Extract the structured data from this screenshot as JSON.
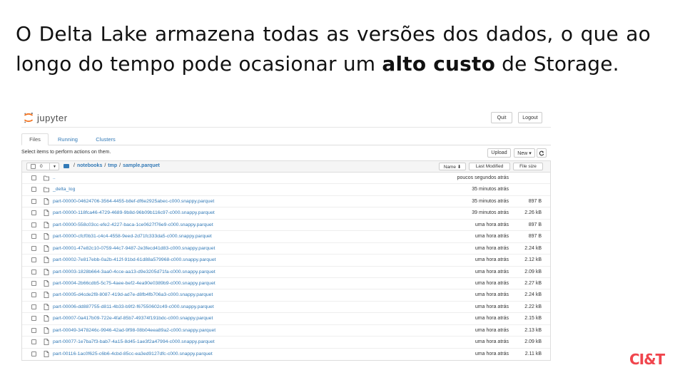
{
  "headline": {
    "text_before": "O Delta Lake armazena todas as versões dos dados, o que ao longo do tempo pode ocasionar um ",
    "bold": "alto custo",
    "text_after": " de Storage."
  },
  "jupyter": {
    "logo_text": "jupyter",
    "quit_label": "Quit",
    "logout_label": "Logout",
    "tabs": [
      "Files",
      "Running",
      "Clusters"
    ],
    "select_text": "Select items to perform actions on them.",
    "upload_label": "Upload",
    "new_label": "New ▾",
    "refresh_icon": "refresh-icon",
    "selected_count": "0",
    "breadcrumb": [
      "notebooks",
      "tmp",
      "sample.parquet"
    ],
    "sort_name_label": "Name ⬇",
    "sort_modified_label": "Last Modified",
    "sort_size_label": "File size",
    "rows": [
      {
        "name": "..",
        "modified": "poucos segundos atrás",
        "size": "",
        "type": "folder"
      },
      {
        "name": "_delta_log",
        "modified": "35 minutos atrás",
        "size": "",
        "type": "folder"
      },
      {
        "name": "part-00000-04624706-3564-4455-b8ef-df6e2925abec-c000.snappy.parquet",
        "modified": "35 minutos atrás",
        "size": "897 B",
        "type": "file"
      },
      {
        "name": "part-00000-118fca46-4729-4689-9b8d-96b09b116c97-c000.snappy.parquet",
        "modified": "39 minutos atrás",
        "size": "2.26 kB",
        "type": "file"
      },
      {
        "name": "part-00000-558c03cc-efe2-4227-baca-1ce0627f76e9-c000.snappy.parquet",
        "modified": "uma hora atrás",
        "size": "897 B",
        "type": "file"
      },
      {
        "name": "part-00000-cfcf0b31-c4c4-4558-9eed-2d71fc333da5-c000.snappy.parquet",
        "modified": "uma hora atrás",
        "size": "897 B",
        "type": "file"
      },
      {
        "name": "part-00001-47e82c10-0759-44c7-9487-2e3fecd41d83-c000.snappy.parquet",
        "modified": "uma hora atrás",
        "size": "2.24 kB",
        "type": "file"
      },
      {
        "name": "part-00002-7e817ebb-0a2b-412f-91bd-61d88a579968-c000.snappy.parquet",
        "modified": "uma hora atrás",
        "size": "2.12 kB",
        "type": "file"
      },
      {
        "name": "part-00003-1828b664-3aa0-4cce-aa13-d9e3205d71fa-c000.snappy.parquet",
        "modified": "uma hora atrás",
        "size": "2.09 kB",
        "type": "file"
      },
      {
        "name": "part-00004-2b66cdb5-5c75-4aee-bef2-4ea90e0389b9-c000.snappy.parquet",
        "modified": "uma hora atrás",
        "size": "2.27 kB",
        "type": "file"
      },
      {
        "name": "part-00005-d4cde2f8-8087-419d-ad7e-d8fb4fb706a3-c000.snappy.parquet",
        "modified": "uma hora atrás",
        "size": "2.24 kB",
        "type": "file"
      },
      {
        "name": "part-00006-dd887755-d811-4b33-b9f2-f67550602c49-c000.snappy.parquet",
        "modified": "uma hora atrás",
        "size": "2.22 kB",
        "type": "file"
      },
      {
        "name": "part-00007-0a417b09-722e-4faf-85b7-49374f191bdc-c000.snappy.parquet",
        "modified": "uma hora atrás",
        "size": "2.15 kB",
        "type": "file"
      },
      {
        "name": "part-00049-3478246c-9946-42ad-9f98-08b04eea89a2-c000.snappy.parquet",
        "modified": "uma hora atrás",
        "size": "2.13 kB",
        "type": "file"
      },
      {
        "name": "part-00077-1e7ba7f3-bab7-4a15-8d45-1ae3f2a47994-c000.snappy.parquet",
        "modified": "uma hora atrás",
        "size": "2.09 kB",
        "type": "file"
      },
      {
        "name": "part-00116-1ac0f625-c6b6-4cbd-85cc-ea3ed9127dfc-c000.snappy.parquet",
        "modified": "uma hora atrás",
        "size": "2.11 kB",
        "type": "file"
      }
    ]
  },
  "brand": {
    "logo_text": "CI&T",
    "color": "#f0454d"
  },
  "colors": {
    "link": "#337ab7",
    "jupyter_orange": "#f37726"
  }
}
